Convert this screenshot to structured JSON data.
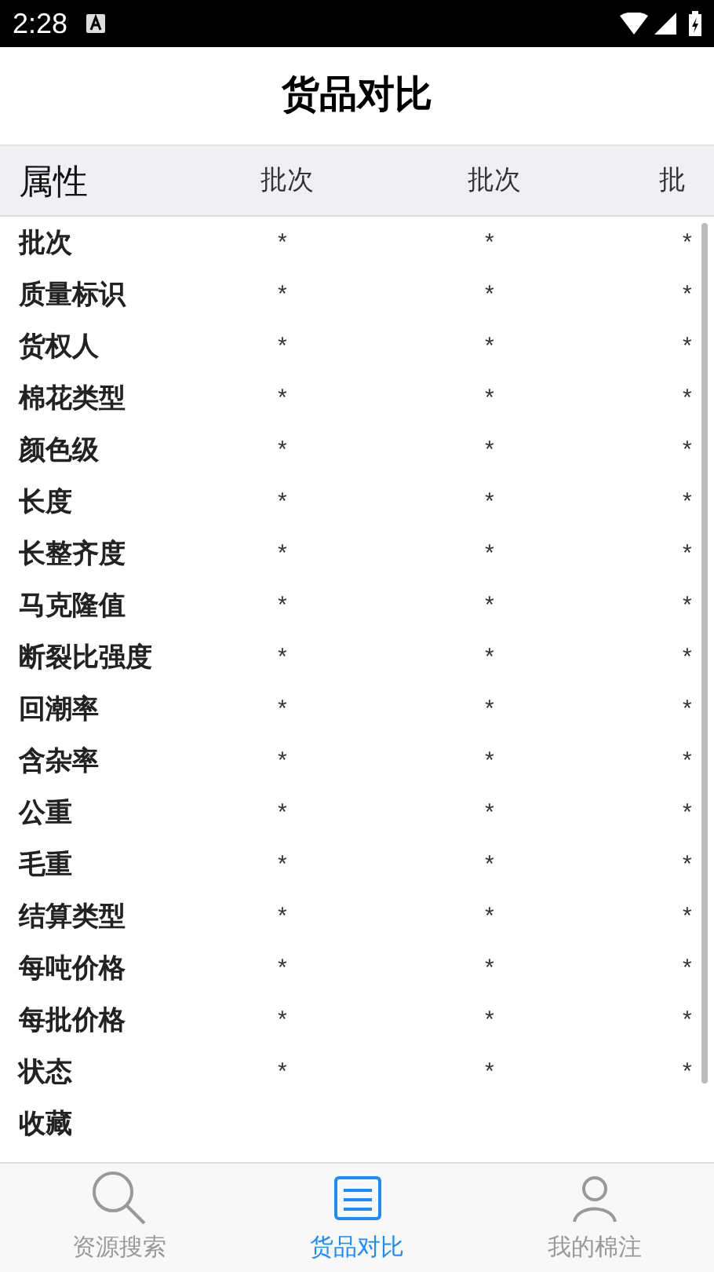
{
  "status_bar": {
    "time": "2:28"
  },
  "title": "货品对比",
  "table": {
    "columns": [
      "属性",
      "批次",
      "批次",
      "批"
    ],
    "rows": [
      {
        "label": "批次",
        "values": [
          "*",
          "*",
          "*"
        ]
      },
      {
        "label": "质量标识",
        "values": [
          "*",
          "*",
          "*"
        ]
      },
      {
        "label": "货权人",
        "values": [
          "*",
          "*",
          "*"
        ]
      },
      {
        "label": "棉花类型",
        "values": [
          "*",
          "*",
          "*"
        ]
      },
      {
        "label": "颜色级",
        "values": [
          "*",
          "*",
          "*"
        ]
      },
      {
        "label": "长度",
        "values": [
          "*",
          "*",
          "*"
        ]
      },
      {
        "label": "长整齐度",
        "values": [
          "*",
          "*",
          "*"
        ]
      },
      {
        "label": "马克隆值",
        "values": [
          "*",
          "*",
          "*"
        ]
      },
      {
        "label": "断裂比强度",
        "values": [
          "*",
          "*",
          "*"
        ]
      },
      {
        "label": "回潮率",
        "values": [
          "*",
          "*",
          "*"
        ]
      },
      {
        "label": "含杂率",
        "values": [
          "*",
          "*",
          "*"
        ]
      },
      {
        "label": "公重",
        "values": [
          "*",
          "*",
          "*"
        ]
      },
      {
        "label": "毛重",
        "values": [
          "*",
          "*",
          "*"
        ]
      },
      {
        "label": "结算类型",
        "values": [
          "*",
          "*",
          "*"
        ]
      },
      {
        "label": "每吨价格",
        "values": [
          "*",
          "*",
          "*"
        ]
      },
      {
        "label": "每批价格",
        "values": [
          "*",
          "*",
          "*"
        ]
      },
      {
        "label": "状态",
        "values": [
          "*",
          "*",
          "*"
        ]
      },
      {
        "label": "收藏"
      }
    ]
  },
  "tabs": [
    {
      "label": "资源搜索",
      "kind": "search",
      "selected": false
    },
    {
      "label": "货品对比",
      "kind": "compare",
      "selected": true
    },
    {
      "label": "我的棉注",
      "kind": "person",
      "selected": false
    }
  ]
}
